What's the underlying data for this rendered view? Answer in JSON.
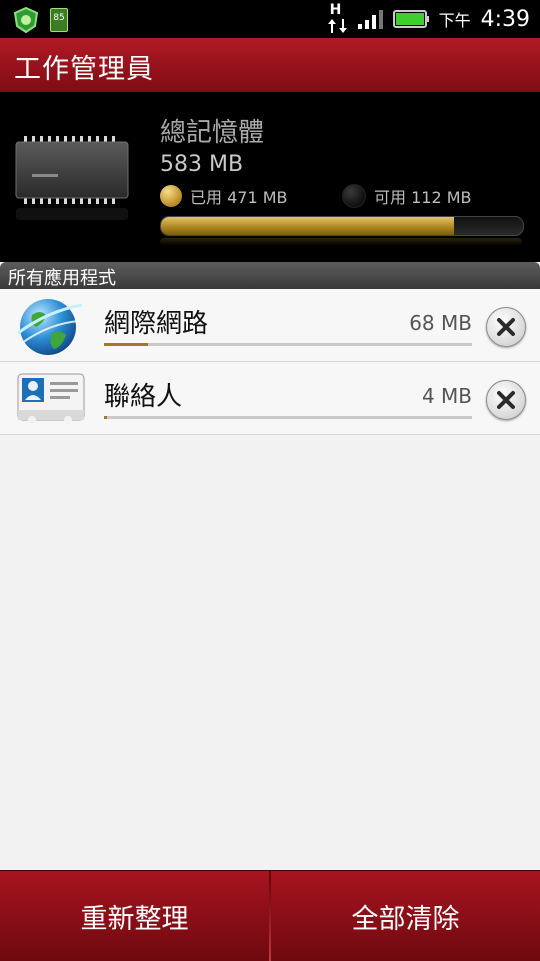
{
  "status_bar": {
    "battery_level_badge": "85",
    "network_type": "H",
    "ampm": "下午",
    "time": "4:39"
  },
  "header": {
    "title": "工作管理員"
  },
  "memory": {
    "title": "總記憶體",
    "total": "583 MB",
    "used_label": "已用 471 MB",
    "free_label": "可用 112 MB",
    "used_fraction": 0.81
  },
  "section": {
    "label": "所有應用程式"
  },
  "apps": [
    {
      "name": "網際網路",
      "size": "68 MB",
      "usage_fraction": 0.12,
      "icon": "globe-icon"
    },
    {
      "name": "聯絡人",
      "size": "4 MB",
      "usage_fraction": 0.008,
      "icon": "contact-card-icon"
    }
  ],
  "buttons": {
    "refresh": "重新整理",
    "clear_all": "全部清除"
  },
  "colors": {
    "accent_red": "#a8141e",
    "memory_gold": "#c9a23a"
  }
}
